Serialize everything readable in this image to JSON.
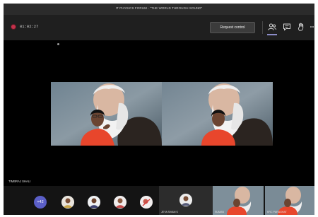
{
  "window": {
    "title": "IT PHYSICS FORUM - \"THE WORLD THROUGH SOUND\""
  },
  "toolbar": {
    "timer": "01:02:27",
    "request_control_label": "Request control",
    "icons": [
      "people-icon",
      "chat-icon",
      "raise-hand-icon",
      "more-options-icon"
    ]
  },
  "stage": {
    "speaker_name": "TIMBRAJ SHALI"
  },
  "tray": {
    "more_count": "+42",
    "tile_names": [
      "JEYA SIVAM S",
      "SUMAN",
      "KRC PARAGHAT"
    ]
  },
  "colors": {
    "accent": "#5b5fc7",
    "record": "#c4314b",
    "toolbar_bg": "#1f1f1f"
  }
}
